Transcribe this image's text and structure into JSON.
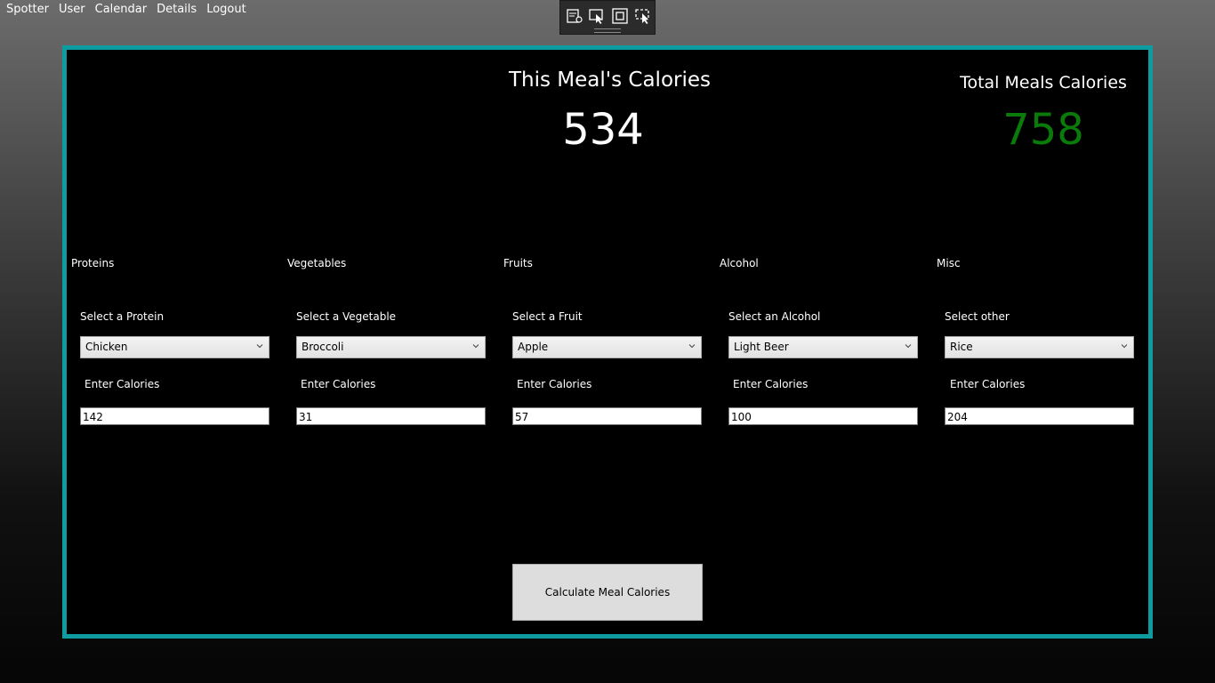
{
  "menu": [
    "Spotter",
    "User",
    "Calendar",
    "Details",
    "Logout"
  ],
  "devtools": {
    "icons": [
      "live-visual-tree-icon",
      "select-element-icon",
      "display-layout-adorners-icon",
      "track-focused-element-icon"
    ]
  },
  "summary": {
    "meal_title": "This Meal's Calories",
    "meal_value": "534",
    "total_title": "Total Meals Calories",
    "total_value": "758",
    "total_color": "#0a7a0a"
  },
  "categories": [
    {
      "label": "Proteins",
      "select_label": "Select a Protein",
      "selected": "Chicken",
      "calories_label": "Enter Calories",
      "calories": "142"
    },
    {
      "label": "Vegetables",
      "select_label": "Select a Vegetable",
      "selected": "Broccoli",
      "calories_label": "Enter Calories",
      "calories": "31"
    },
    {
      "label": "Fruits",
      "select_label": "Select a Fruit",
      "selected": "Apple",
      "calories_label": "Enter Calories",
      "calories": "57"
    },
    {
      "label": "Alcohol",
      "select_label": "Select an Alcohol",
      "selected": "Light Beer",
      "calories_label": "Enter Calories",
      "calories": "100"
    },
    {
      "label": "Misc",
      "select_label": "Select other",
      "selected": "Rice",
      "calories_label": "Enter Calories",
      "calories": "204"
    }
  ],
  "calculate_button": "Calculate Meal Calories",
  "colors": {
    "frame_border": "#0e9ca0",
    "panel_bg": "#000000"
  }
}
